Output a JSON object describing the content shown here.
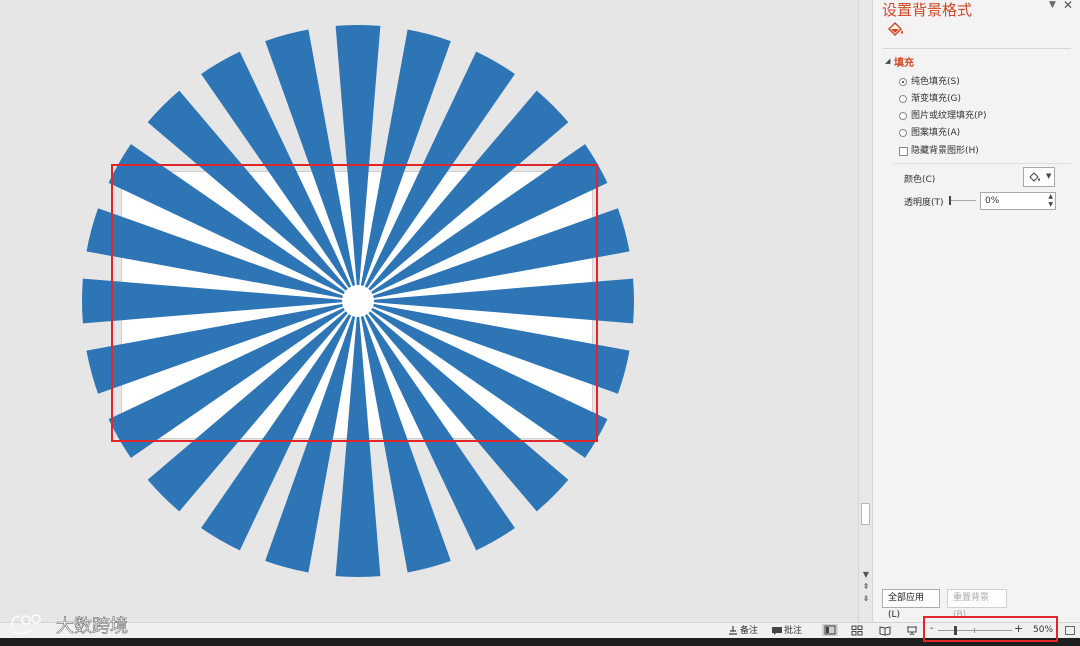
{
  "pane": {
    "title": "设置背景格式",
    "section_fill": "填充",
    "fill_options": [
      {
        "label": "纯色填充(S)",
        "selected": true
      },
      {
        "label": "渐变填充(G)",
        "selected": false
      },
      {
        "label": "图片或纹理填充(P)",
        "selected": false
      },
      {
        "label": "图案填充(A)",
        "selected": false
      }
    ],
    "hide_bg_graphics": {
      "label": "隐藏背景图形(H)",
      "checked": false
    },
    "color_label": "颜色(C)",
    "transparency_label": "透明度(T)",
    "transparency_value": "0%",
    "apply_all_label": "全部应用(L)",
    "reset_bg_label": "重置背景(B)"
  },
  "statusbar": {
    "notes_label": "备注",
    "comments_label": "批注",
    "zoom_value": "50%",
    "zoom_minus": "-",
    "zoom_plus": "+"
  },
  "watermark": {
    "text": "大数跨境"
  },
  "colors": {
    "ray_blue": "#2e75b6",
    "accent_orange": "#d24726",
    "highlight_red": "#e0252b"
  },
  "icons": [
    "fill-bucket-icon",
    "notes-icon",
    "comments-icon",
    "normal-view-icon",
    "slide-sorter-icon",
    "reading-view-icon",
    "slideshow-icon",
    "fit-slide-icon"
  ]
}
